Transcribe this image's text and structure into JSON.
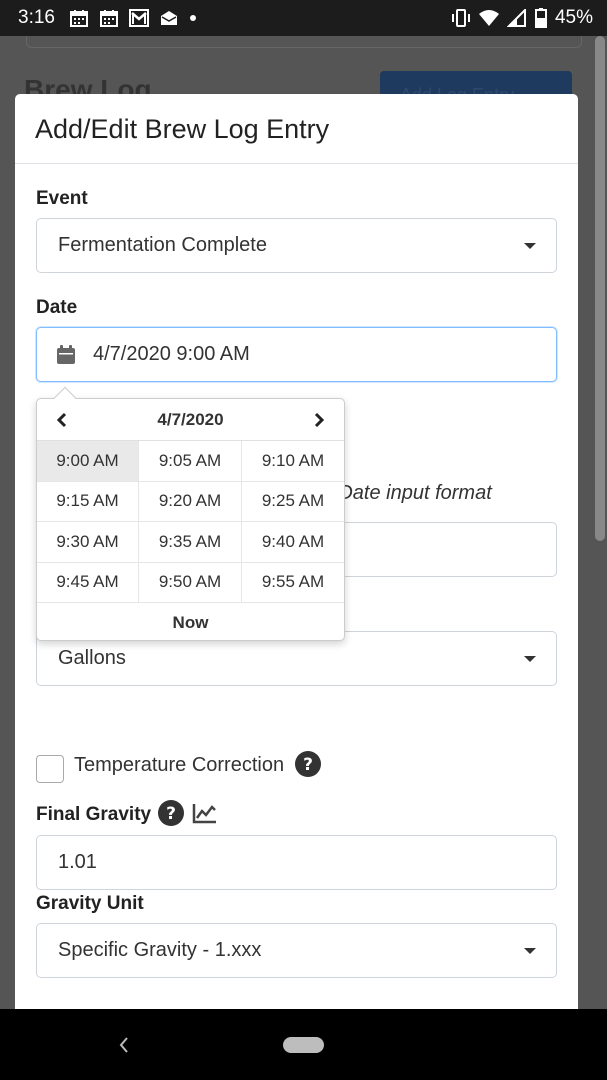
{
  "status_bar": {
    "time": "3:16",
    "battery": "45%",
    "notification_icons": [
      "calendar-icon",
      "calendar-icon",
      "gmail-icon",
      "email-icon",
      "dot-icon"
    ],
    "system_icons": [
      "vibrate-icon",
      "wifi-icon",
      "signal-icon",
      "battery-icon"
    ]
  },
  "background": {
    "title": "Brew Log",
    "button": "Add Log Entry"
  },
  "modal": {
    "title": "Add/Edit Brew Log Entry",
    "event_label": "Event",
    "event_value": "Fermentation Complete",
    "date_label": "Date",
    "date_value": "4/7/2020 9:00 AM",
    "date_help_partial": "ank. Date input format",
    "volume_unit_value": "Gallons",
    "temp_correction_label": "Temperature Correction",
    "final_gravity_label": "Final Gravity",
    "final_gravity_value": "1.01",
    "gravity_unit_label": "Gravity Unit",
    "gravity_unit_value": "Specific Gravity - 1.xxx"
  },
  "time_picker": {
    "date": "4/7/2020",
    "times": [
      "9:00 AM",
      "9:05 AM",
      "9:10 AM",
      "9:15 AM",
      "9:20 AM",
      "9:25 AM",
      "9:30 AM",
      "9:35 AM",
      "9:40 AM",
      "9:45 AM",
      "9:50 AM",
      "9:55 AM"
    ],
    "selected": "9:00 AM",
    "now_label": "Now"
  },
  "colors": {
    "focus_border": "#80bdff",
    "text": "#333333",
    "selected_cell": "#e9e9e9"
  }
}
